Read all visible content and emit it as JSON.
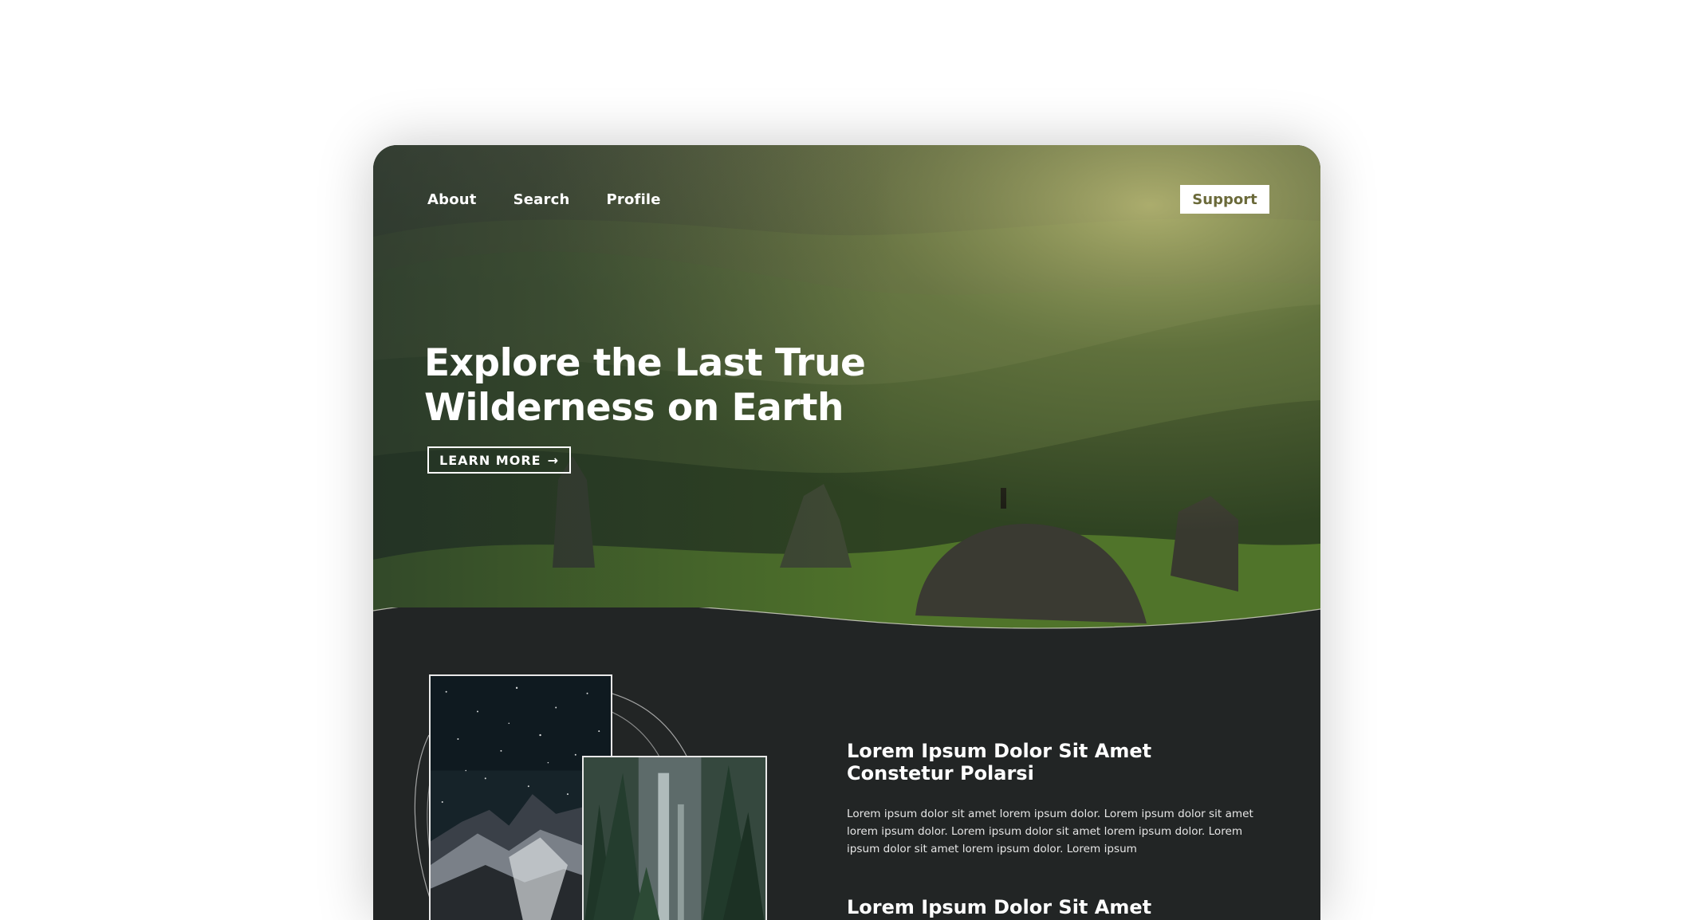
{
  "nav": {
    "links": [
      "About",
      "Search",
      "Profile"
    ],
    "support_label": "Support"
  },
  "hero": {
    "title": "Explore the Last True Wilderness on Earth",
    "cta_label": "LEARN MORE",
    "cta_arrow": "→"
  },
  "features": [
    {
      "title": "Lorem Ipsum Dolor Sit Amet Constetur Polarsi",
      "text": "Lorem ipsum dolor sit amet lorem ipsum dolor. Lorem ipsum dolor sit amet lorem ipsum dolor. Lorem ipsum dolor sit amet lorem ipsum dolor. Lorem ipsum dolor sit amet lorem ipsum dolor. Lorem ipsum"
    },
    {
      "title": "Lorem Ipsum Dolor Sit Amet"
    }
  ],
  "colors": {
    "page_background": "#ffffff",
    "section_background": "#222525",
    "support_text": "#6b6a3a",
    "hero_tint": "#7d8a3c"
  },
  "images": {
    "hero": "mountain-wilderness-landscape",
    "collage_1": "starry-night-mountain",
    "collage_2": "forest-waterfall"
  }
}
